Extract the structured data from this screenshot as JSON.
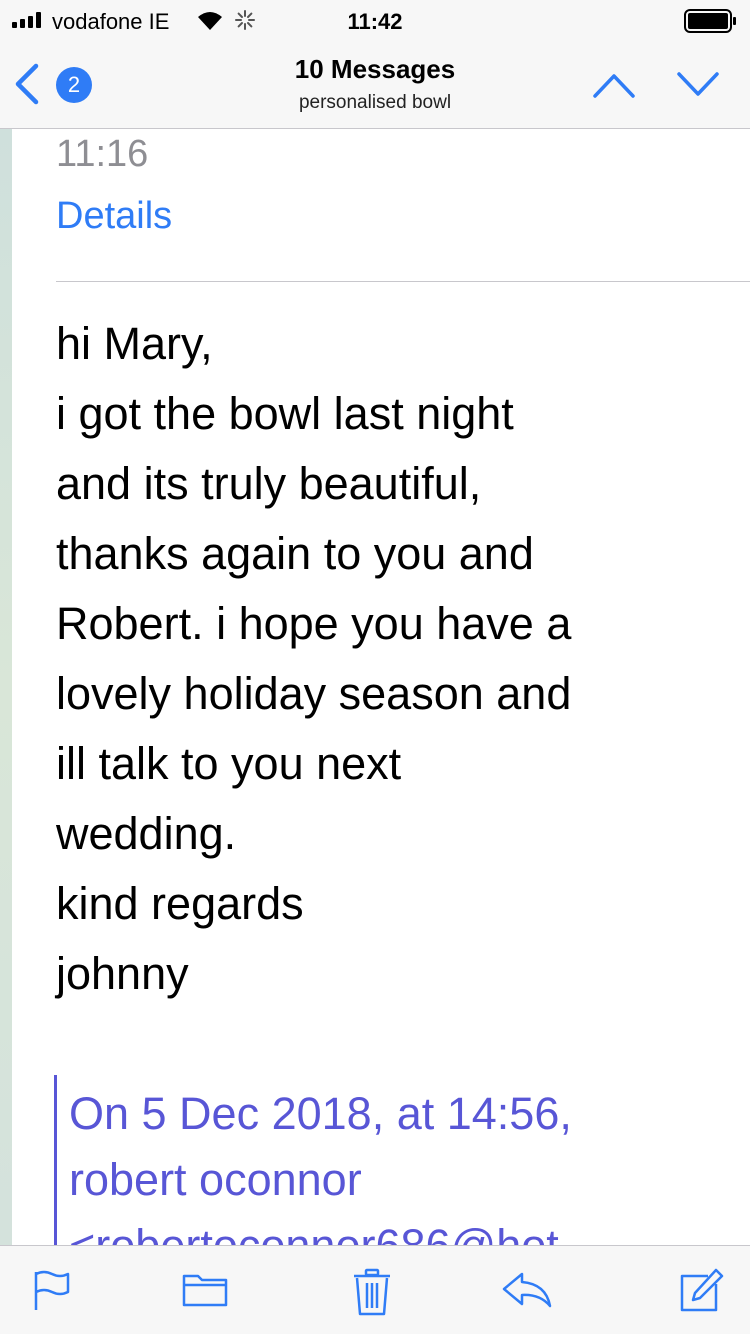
{
  "status_bar": {
    "carrier": "vodafone IE",
    "time": "11:42"
  },
  "nav": {
    "back_count": "2",
    "title": "10 Messages",
    "subtitle": "personalised bowl"
  },
  "message": {
    "time": "11:16",
    "details_label": "Details",
    "body_lines": [
      "hi Mary,",
      "i got the bowl last night",
      "and its truly beautiful,",
      "thanks again to you and",
      "Robert. i hope you have a",
      "lovely holiday season and",
      "ill talk to you next",
      "wedding.",
      "kind regards",
      "johnny"
    ],
    "quote_lines": [
      "On 5 Dec 2018, at 14:56,",
      "robert oconnor",
      "<robertoconnor686@hot"
    ]
  },
  "toolbar": {
    "icons": [
      "flag-icon",
      "folder-icon",
      "trash-icon",
      "reply-icon",
      "compose-icon"
    ]
  },
  "colors": {
    "accent": "#2f7cf6",
    "quote": "#5856d6",
    "muted": "#8e8e93"
  }
}
